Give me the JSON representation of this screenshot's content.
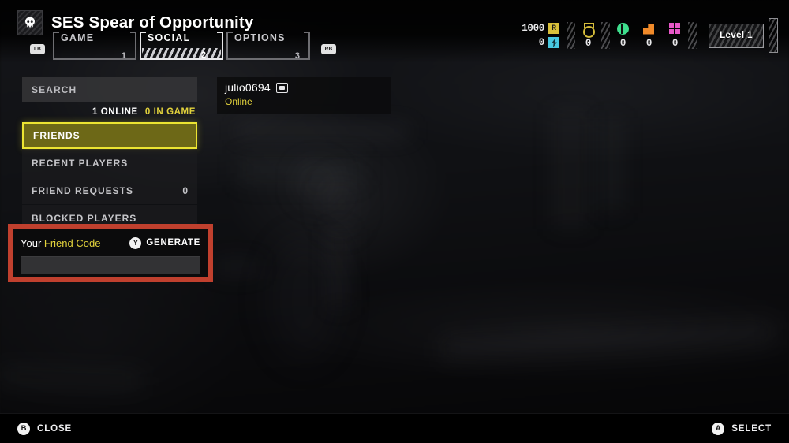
{
  "header": {
    "ship_name": "SES Spear of Opportunity",
    "ship_icon": "skull-icon",
    "left_bumper": "LB",
    "right_bumper": "RB",
    "tabs": [
      {
        "label": "GAME",
        "number": "1",
        "active": false
      },
      {
        "label": "SOCIAL",
        "number": "2",
        "active": true
      },
      {
        "label": "OPTIONS",
        "number": "3",
        "active": false
      }
    ]
  },
  "hud": {
    "requisition": {
      "value": "1000",
      "icon": "requisition-slip-icon",
      "glyph": "R",
      "color": "#d9c03a"
    },
    "samples_common": {
      "value": "0",
      "icon": "sample-icon",
      "glyph": "⚡",
      "color": "#48c8e0"
    },
    "medals": {
      "value": "0",
      "icon": "medal-icon",
      "color": "#d6bd3b"
    },
    "green_resource": {
      "value": "0",
      "icon": "green-sample-icon",
      "color": "#3ede8d"
    },
    "orange_resource": {
      "value": "0",
      "icon": "orange-sample-icon",
      "color": "#f08a2a"
    },
    "magenta_resource": {
      "value": "0",
      "icon": "magenta-sample-icon",
      "color": "#e857c8"
    },
    "level_badge": "Level 1"
  },
  "sidebar": {
    "search": {
      "placeholder": "SEARCH",
      "value": ""
    },
    "status": {
      "online": "1 ONLINE",
      "in_game": "0 IN GAME",
      "in_game_color": "#e2d23c"
    },
    "items": [
      {
        "label": "FRIENDS",
        "count": "",
        "selected": true
      },
      {
        "label": "RECENT PLAYERS",
        "count": "",
        "selected": false
      },
      {
        "label": "FRIEND REQUESTS",
        "count": "0",
        "selected": false
      },
      {
        "label": "BLOCKED PLAYERS",
        "count": "",
        "selected": false
      }
    ],
    "friend_code": {
      "label_white": "Your ",
      "label_yellow": "Friend Code",
      "generate_button": "Y",
      "generate_label": "GENERATE",
      "field_value": "",
      "highlight_color": "#c0402e"
    }
  },
  "friend_card": {
    "name": "julio0694",
    "platform_icon": "pc-monitor-icon",
    "status": "Online",
    "status_color": "#e2d23c"
  },
  "footer": {
    "close_button": "B",
    "close_label": "CLOSE",
    "select_button": "A",
    "select_label": "SELECT"
  }
}
